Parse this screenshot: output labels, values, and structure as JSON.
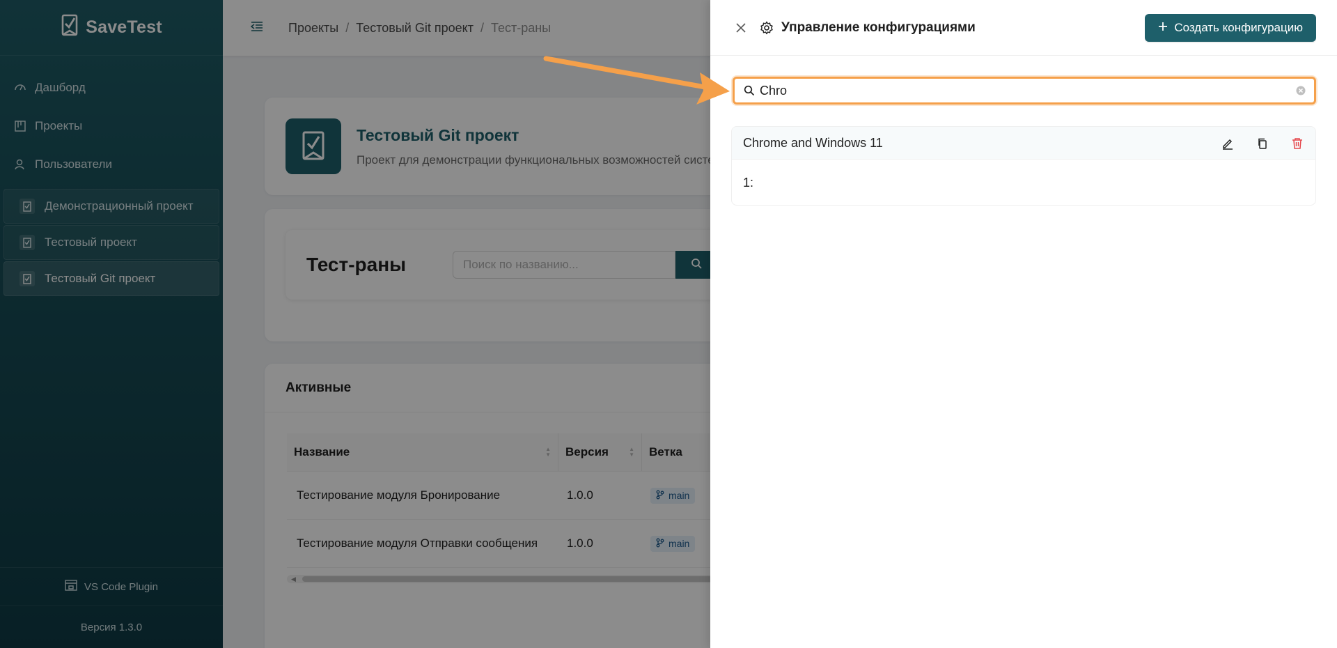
{
  "app": {
    "logo_text": "SaveTest"
  },
  "sidebar": {
    "nav": [
      {
        "label": "Дашборд",
        "icon": "dashboard-icon"
      },
      {
        "label": "Проекты",
        "icon": "projects-icon"
      },
      {
        "label": "Пользователи",
        "icon": "users-icon"
      }
    ],
    "projects": [
      {
        "label": "Демонстрационный проект"
      },
      {
        "label": "Тестовый проект"
      },
      {
        "label": "Тестовый Git проект"
      }
    ],
    "plugin_label": "VS Code Plugin",
    "version": "Версия 1.3.0"
  },
  "breadcrumb": {
    "items": [
      "Проекты",
      "Тестовый Git проект",
      "Тест-раны"
    ],
    "sep": "/"
  },
  "project": {
    "title": "Тестовый Git проект",
    "description": "Проект для демонстрации функциональных возможностей системы"
  },
  "runs": {
    "title": "Тест-раны",
    "search_placeholder": "Поиск по названию..."
  },
  "table": {
    "section_title": "Активные",
    "columns": [
      "Название",
      "Версия",
      "Ветка"
    ],
    "rows": [
      {
        "name": "Тестирование модуля Бронирование",
        "version": "1.0.0",
        "branch": "main"
      },
      {
        "name": "Тестирование модуля Отправки сообщения",
        "version": "1.0.0",
        "branch": "main"
      }
    ]
  },
  "drawer": {
    "title": "Управление конфигурациями",
    "create_label": "Создать конфигурацию",
    "search_value": "Chro",
    "configs": [
      {
        "name": "Chrome and Windows 11",
        "body": "1:"
      }
    ]
  },
  "colors": {
    "accent": "#1e5f6a",
    "highlight": "#f5a04a",
    "danger": "#e5484d"
  }
}
